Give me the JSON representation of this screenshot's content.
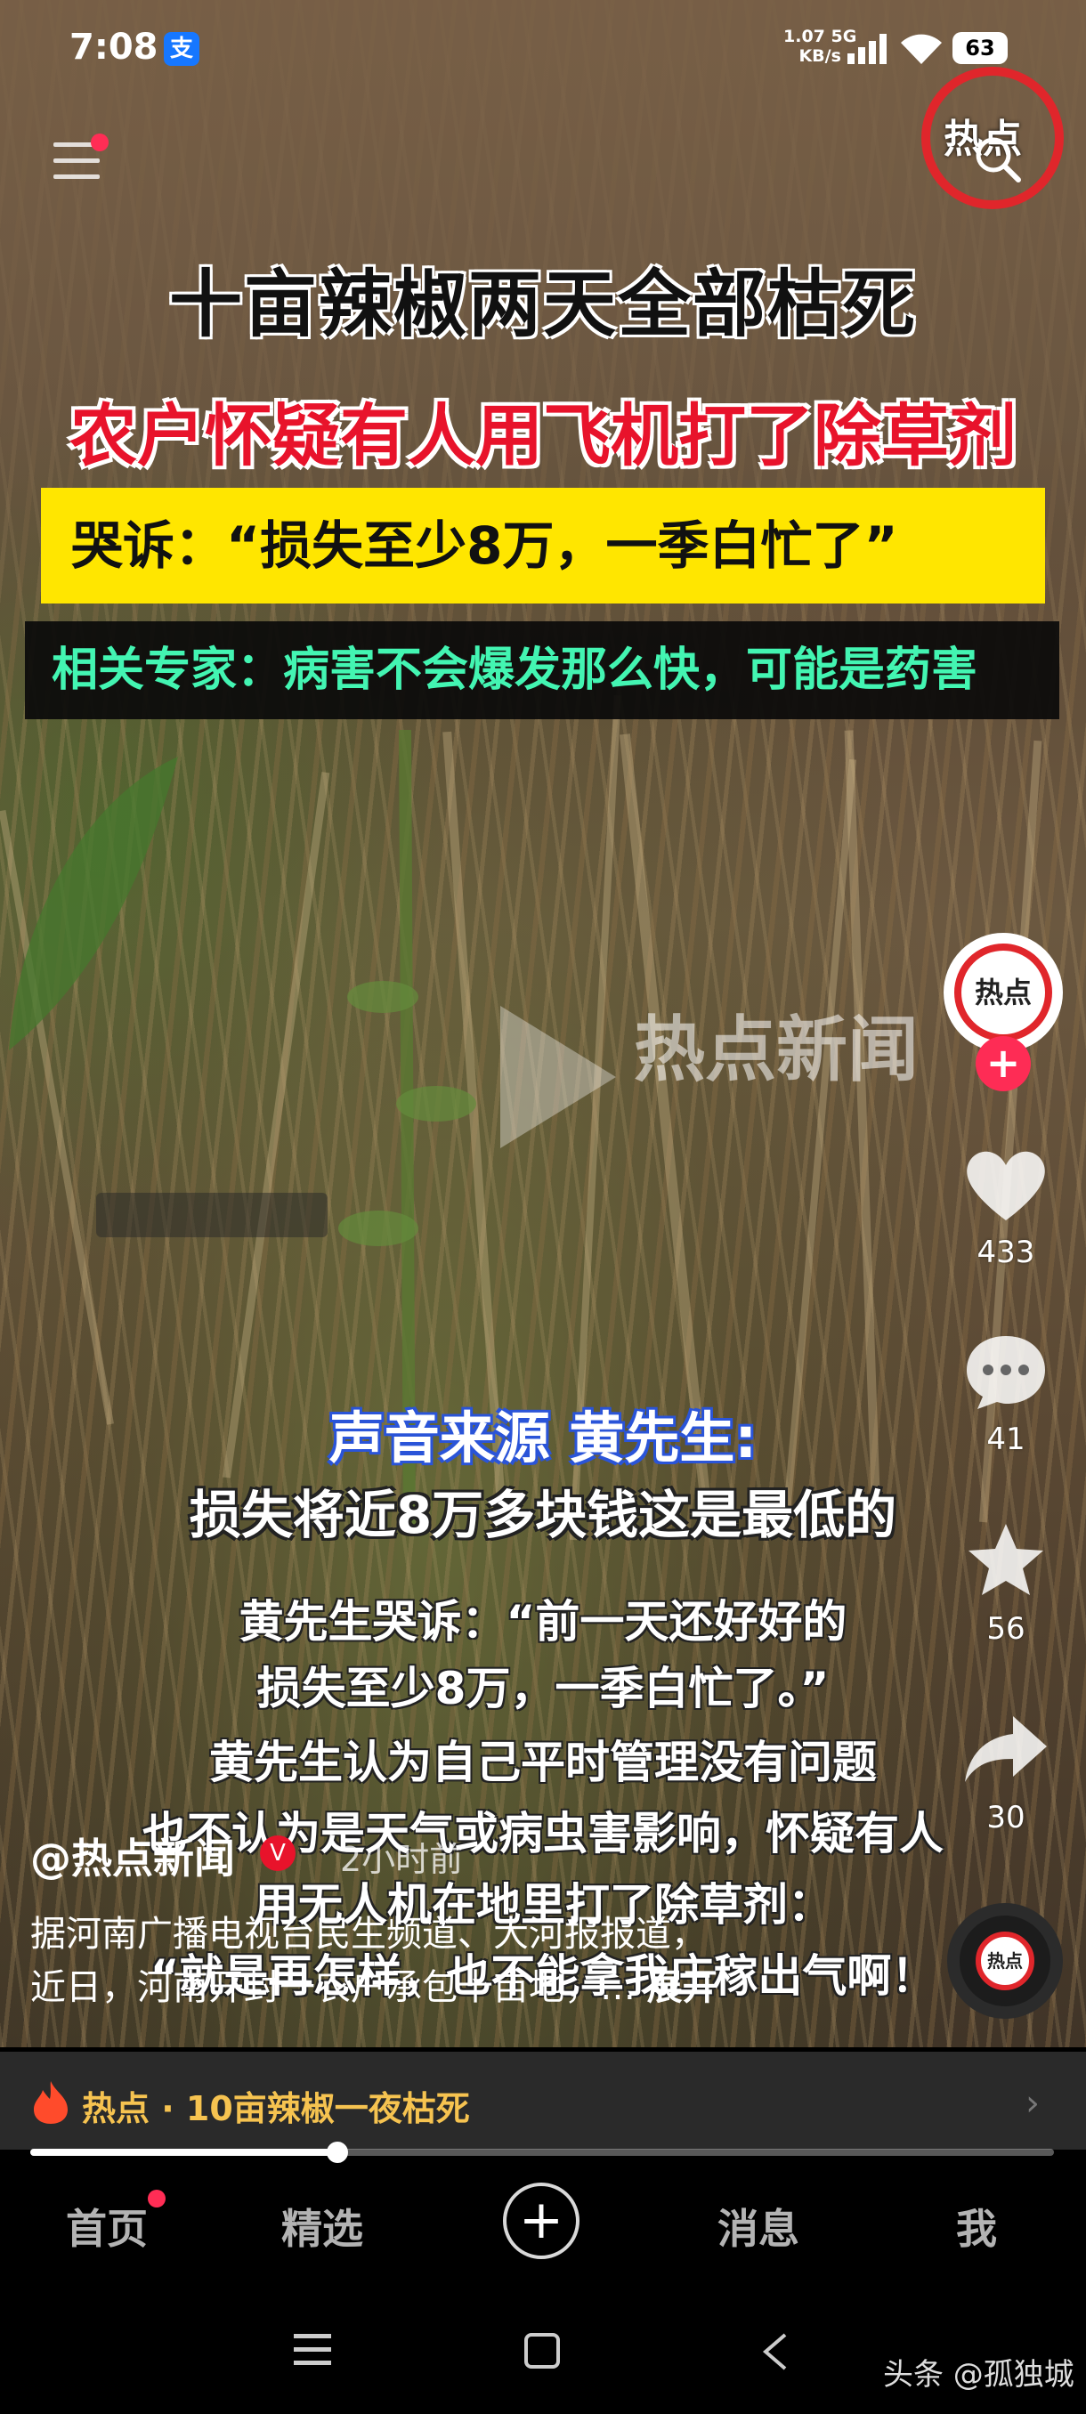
{
  "status_bar": {
    "time": "7:08",
    "alipay_badge": "支",
    "net_speed_value": "1.07",
    "net_speed_unit": "KB/s",
    "network_type": "5G",
    "battery": "63"
  },
  "header": {
    "hot_logo_text": "热点",
    "menu_icon": "menu-icon",
    "search_icon": "search-icon"
  },
  "video": {
    "headline_1": "十亩辣椒两天全部枯死",
    "headline_2": "农户怀疑有人用飞机打了除草剂",
    "headline_3": "哭诉：“损失至少8万，一季白忙了”",
    "headline_4": "相关专家：病害不会爆发那么快，可能是药害",
    "watermark": "热点新闻",
    "speaker_label": "声音来源 黄先生:",
    "speaker_quote": "损失将近8万多块钱这是最低的",
    "caption_lines": [
      "黄先生哭诉：“前一天还好好的",
      "损失至少8万，一季白忙了。”",
      "黄先生认为自己平时管理没有问题",
      "也不认为是天气或病虫害影响，怀疑有人",
      "用无人机在地里打了除草剂：",
      "“就是再怎样，也不能拿我庄稼出气啊！"
    ]
  },
  "actions": {
    "avatar_text": "热点",
    "follow_label": "+",
    "likes": "433",
    "comments": "41",
    "favorites": "56",
    "shares": "30"
  },
  "post": {
    "author": "@热点新闻",
    "verified_mark": "V",
    "time_ago": "2小时前",
    "desc_line_1": "据河南广播电视台民生频道、大河报报道，",
    "desc_line_2": "近日，河南开封一农户承包十亩地，…",
    "expand_label": "展开",
    "music_disc_text": "热点"
  },
  "hot_topic": {
    "label": "热点 · 10亩辣椒一夜枯死",
    "arrow": "›"
  },
  "progress": {
    "fraction": 0.3
  },
  "bottom_nav": {
    "home": "首页",
    "featured": "精选",
    "create": "+",
    "messages": "消息",
    "me": "我"
  },
  "credit": "头条 @孤独城",
  "colors": {
    "accent_red": "#e8132b",
    "caption_yellow": "#ffe600",
    "caption_green": "#43f5b2",
    "hot_gold": "#f6c350"
  }
}
